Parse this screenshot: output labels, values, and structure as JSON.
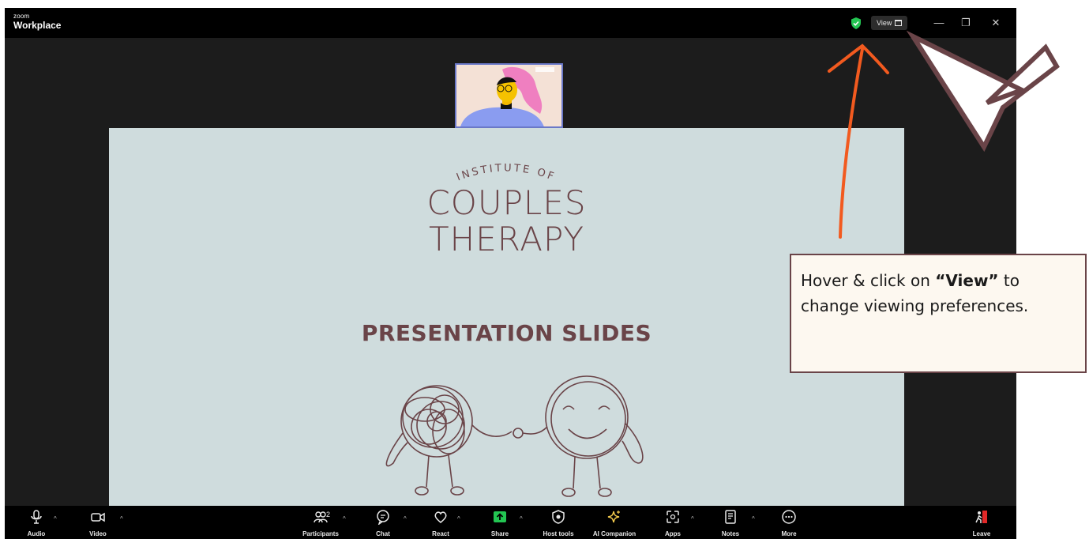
{
  "app": {
    "brand_small": "zoom",
    "brand_large": "Workplace"
  },
  "titlebar": {
    "view_label": "View",
    "minimize": "—",
    "restore": "❐",
    "close": "✕"
  },
  "slide": {
    "institute": "INSTITUTE OF",
    "line1": "COUPLES",
    "line2": "THERAPY",
    "subtitle": "PRESENTATION SLIDES"
  },
  "toolbar": {
    "items": [
      {
        "label": "Audio",
        "icon": "microphone-icon"
      },
      {
        "label": "Video",
        "icon": "video-camera-icon"
      },
      {
        "label": "Participants",
        "icon": "participants-icon",
        "count": "2"
      },
      {
        "label": "Chat",
        "icon": "chat-icon"
      },
      {
        "label": "React",
        "icon": "heart-icon"
      },
      {
        "label": "Share",
        "icon": "share-arrow-icon"
      },
      {
        "label": "Host tools",
        "icon": "shield-icon"
      },
      {
        "label": "AI Companion",
        "icon": "sparkle-icon"
      },
      {
        "label": "Apps",
        "icon": "apps-icon"
      },
      {
        "label": "Notes",
        "icon": "notes-icon"
      },
      {
        "label": "More",
        "icon": "more-icon"
      },
      {
        "label": "Leave",
        "icon": "leave-icon"
      }
    ]
  },
  "callout": {
    "pre": "Hover & click on ",
    "highlight": "“View”",
    "post": " to change viewing preferences."
  },
  "colors": {
    "accent_orange": "#f25a1f",
    "slide_bg": "#cfdcdd",
    "slide_text": "#6a4448",
    "share_green": "#23c552",
    "ai_gold": "#f2c94c"
  }
}
